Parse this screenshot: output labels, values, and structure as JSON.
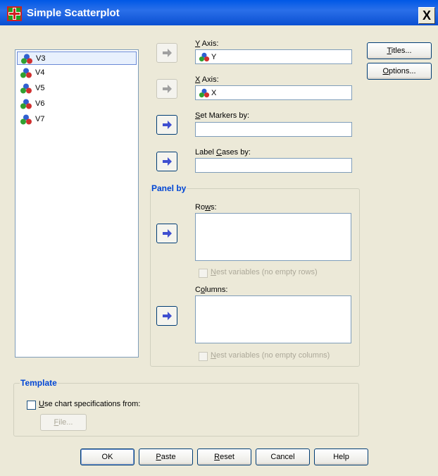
{
  "window": {
    "title": "Simple Scatterplot",
    "close_glyph": "X"
  },
  "variables": {
    "items": [
      {
        "label": "V3",
        "icon": "nominal-variable-icon",
        "selected": true
      },
      {
        "label": "V4",
        "icon": "nominal-variable-icon"
      },
      {
        "label": "V5",
        "icon": "nominal-variable-icon"
      },
      {
        "label": "V6",
        "icon": "nominal-variable-icon"
      },
      {
        "label": "V7",
        "icon": "nominal-variable-icon"
      }
    ]
  },
  "y_axis": {
    "label_mn": "Y",
    "label_rest": " Axis:",
    "value": "Y"
  },
  "x_axis": {
    "label_mn": "X",
    "label_rest": " Axis:",
    "value": "X"
  },
  "set_markers": {
    "label_mn": "S",
    "label_rest": "et Markers by:",
    "value": ""
  },
  "label_cases": {
    "label_pre": "Label ",
    "label_mn": "C",
    "label_rest": "ases by:",
    "value": ""
  },
  "panel": {
    "title": "Panel by",
    "rows": {
      "label_pre": "Ro",
      "label_mn": "w",
      "label_rest": "s:"
    },
    "nest_rows": {
      "label_mn": "N",
      "label_rest": "est variables (no empty rows)",
      "checked": false,
      "enabled": false
    },
    "columns": {
      "label_pre": "C",
      "label_mn": "o",
      "label_rest": "lumns:"
    },
    "nest_cols": {
      "label_mn": "N",
      "label_rest": "est variables (no empty columns)",
      "checked": false,
      "enabled": false
    }
  },
  "side_buttons": {
    "titles": {
      "mn": "T",
      "rest": "itles..."
    },
    "options": {
      "mn": "O",
      "rest": "ptions..."
    }
  },
  "template": {
    "title": "Template",
    "use_spec": {
      "label_mn": "U",
      "label_rest": "se chart specifications from:",
      "checked": false
    },
    "file": {
      "mn": "F",
      "rest": "ile..."
    }
  },
  "buttons": {
    "ok": "OK",
    "paste": {
      "mn": "P",
      "rest": "aste"
    },
    "reset": {
      "mn": "R",
      "rest": "eset"
    },
    "cancel": "Cancel",
    "help": "Help"
  },
  "colors": {
    "title_bar": "#0a4fd1",
    "dialog_bg": "#ece9d8",
    "group_title": "#0046d5",
    "arrow_enabled": "#3f4fd0",
    "arrow_disabled": "#a0a0a0"
  }
}
